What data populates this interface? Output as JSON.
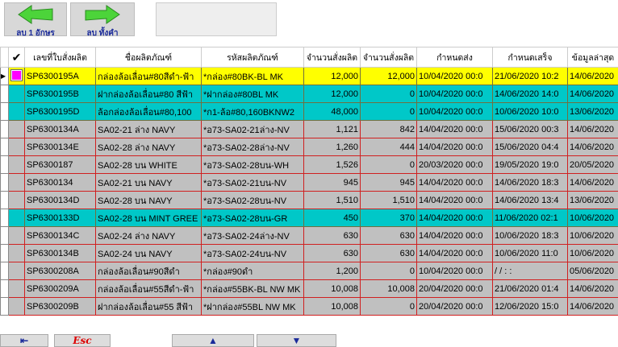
{
  "toolbar": {
    "delete_one_label": "ลบ 1 อักษร",
    "delete_all_label": "ลบ ทั้งคำ",
    "input_value": ""
  },
  "columns": [
    "✔",
    "เลขที่ใบสั่งผลิต",
    "ชื่อผลิตภัณฑ์",
    "รหัสผลิตภัณฑ์",
    "จำนวนสั่งผลิต",
    "จำนวนสั่งผลิต",
    "กำหนดส่ง",
    "กำหนดเสร็จ",
    "ข้อมูลล่าสุด"
  ],
  "rows": [
    {
      "style": "y",
      "order": "SP6300195A",
      "name": "กล่องล้อเลื่อน#80สีดำ-ฟ้า",
      "code": "*กล่อง#80BK-BL MK",
      "qty1": "12,000",
      "qty2": "12,000",
      "due": "10/04/2020 00:0",
      "done": "21/06/2020 10:2",
      "last": "14/06/2020"
    },
    {
      "style": "c",
      "order": "SP6300195B",
      "name": "ฝากล่องล้อเลื่อน#80 สีฟ้า",
      "code": "*ฝากล่อง#80BL MK",
      "qty1": "12,000",
      "qty2": "0",
      "due": "10/04/2020 00:0",
      "done": "14/06/2020 14:0",
      "last": "14/06/2020"
    },
    {
      "style": "c",
      "order": "SP6300195D",
      "name": "ล้อกล่องล้อเลื่อน#80,100",
      "code": "*ก1-ล้อ#80,160BKNW2",
      "qty1": "48,000",
      "qty2": "0",
      "due": "10/04/2020 00:0",
      "done": "10/06/2020 10:0",
      "last": "13/06/2020"
    },
    {
      "style": "g",
      "order": "SP6300134A",
      "name": "SA02-21 ล่าง NAVY",
      "code": "*อ73-SA02-21ล่าง-NV",
      "qty1": "1,121",
      "qty2": "842",
      "due": "14/04/2020 00:0",
      "done": "15/06/2020 00:3",
      "last": "14/06/2020"
    },
    {
      "style": "g",
      "order": "SP6300134E",
      "name": "SA02-28 ล่าง NAVY",
      "code": "*อ73-SA02-28ล่าง-NV",
      "qty1": "1,260",
      "qty2": "444",
      "due": "14/04/2020 00:0",
      "done": "15/06/2020 04:4",
      "last": "14/06/2020"
    },
    {
      "style": "g",
      "order": "SP6300187",
      "name": "SA02-28 บน WHITE",
      "code": "*อ73-SA02-28บน-WH",
      "qty1": "1,526",
      "qty2": "0",
      "due": "20/03/2020 00:0",
      "done": "19/05/2020 19:0",
      "last": "20/05/2020"
    },
    {
      "style": "g",
      "order": "SP6300134",
      "name": "SA02-21 บน NAVY",
      "code": "*อ73-SA02-21บน-NV",
      "qty1": "945",
      "qty2": "945",
      "due": "14/04/2020 00:0",
      "done": "14/06/2020 18:3",
      "last": "14/06/2020"
    },
    {
      "style": "g",
      "order": "SP6300134D",
      "name": "SA02-28 บน NAVY",
      "code": "*อ73-SA02-28บน-NV",
      "qty1": "1,510",
      "qty2": "1,510",
      "due": "14/04/2020 00:0",
      "done": "14/06/2020 13:4",
      "last": "13/06/2020"
    },
    {
      "style": "c",
      "order": "SP6300133D",
      "name": "SA02-28 บน MINT GREE",
      "code": "*อ73-SA02-28บน-GR",
      "qty1": "450",
      "qty2": "370",
      "due": "14/04/2020 00:0",
      "done": "11/06/2020 02:1",
      "last": "10/06/2020"
    },
    {
      "style": "g",
      "order": "SP6300134C",
      "name": "SA02-24 ล่าง NAVY",
      "code": "*อ73-SA02-24ล่าง-NV",
      "qty1": "630",
      "qty2": "630",
      "due": "14/04/2020 00:0",
      "done": "10/06/2020 18:3",
      "last": "10/06/2020"
    },
    {
      "style": "g",
      "order": "SP6300134B",
      "name": "SA02-24 บน NAVY",
      "code": "*อ73-SA02-24บน-NV",
      "qty1": "630",
      "qty2": "630",
      "due": "14/04/2020 00:0",
      "done": "10/06/2020 11:0",
      "last": "10/06/2020"
    },
    {
      "style": "g",
      "order": "SP6300208A",
      "name": "กล่องล้อเลื่อน#90สีดำ",
      "code": "*กล่อง#90ดำ",
      "qty1": "1,200",
      "qty2": "0",
      "due": "10/04/2020 00:0",
      "done": "/  /       :  :",
      "last": "05/06/2020"
    },
    {
      "style": "g",
      "order": "SP6300209A",
      "name": "กล่องล้อเลื่อน#55สีดำ-ฟ้า",
      "code": "*กล่อง#55BK-BL NW MK",
      "qty1": "10,008",
      "qty2": "10,008",
      "due": "20/04/2020 00:0",
      "done": "21/06/2020 01:4",
      "last": "14/06/2020"
    },
    {
      "style": "g",
      "order": "SP6300209B",
      "name": "ฝากล่องล้อเลื่อน#55 สีฟ้า",
      "code": "*ฝากล่อง#55BL NW MK",
      "qty1": "10,008",
      "qty2": "0",
      "due": "20/04/2020 00:0",
      "done": "12/06/2020 15:0",
      "last": "14/06/2020"
    }
  ],
  "bottom": {
    "esc_label": "Esc"
  }
}
